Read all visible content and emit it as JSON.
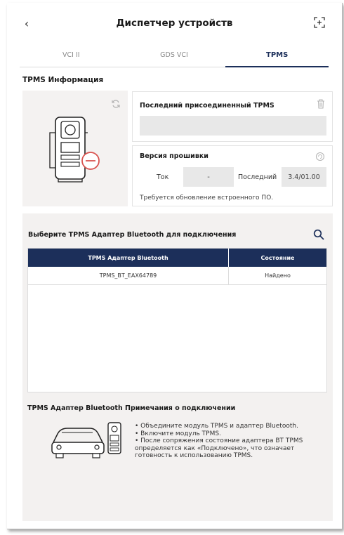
{
  "header": {
    "title": "Диспетчер устройств",
    "back_icon": "chevron-left-icon",
    "scan_icon": "scan-frame-icon"
  },
  "tabs": [
    {
      "label": "VCI II",
      "active": false
    },
    {
      "label": "GDS VCI",
      "active": false
    },
    {
      "label": "TPMS",
      "active": true
    }
  ],
  "tpms_info": {
    "title": "TPMS Информация",
    "last_connected_label": "Последний присоединенный TPMS",
    "last_connected_value": "",
    "firmware": {
      "label": "Версия прошивки",
      "current_label": "Ток",
      "current_value": "-",
      "latest_label": "Последний",
      "latest_value": "3.4/01.00",
      "note": "Требуется обновление встроенного ПО."
    }
  },
  "adapter_select": {
    "title": "Выберите TPMS Адаптер Bluetooth для подключения",
    "columns": [
      "TPMS Адаптер Bluetooth",
      "Состояние"
    ],
    "rows": [
      {
        "name": "TPMS_BT_EAX64789",
        "status": "Найдено"
      }
    ]
  },
  "notes": {
    "title": "TPMS Адаптер Bluetooth Примечания о подключении",
    "lines": [
      "• Объедините модуль TPMS и адаптер Bluetooth.",
      "• Включите модуль TPMS.",
      "• После сопряжения состояние адаптера BT TPMS определяется как «Подключено», что означает готовность к использованию TPMS."
    ]
  },
  "colors": {
    "accent": "#1c2f5a",
    "panel_bg": "#f3f1f0",
    "status_red": "#d9534f"
  }
}
